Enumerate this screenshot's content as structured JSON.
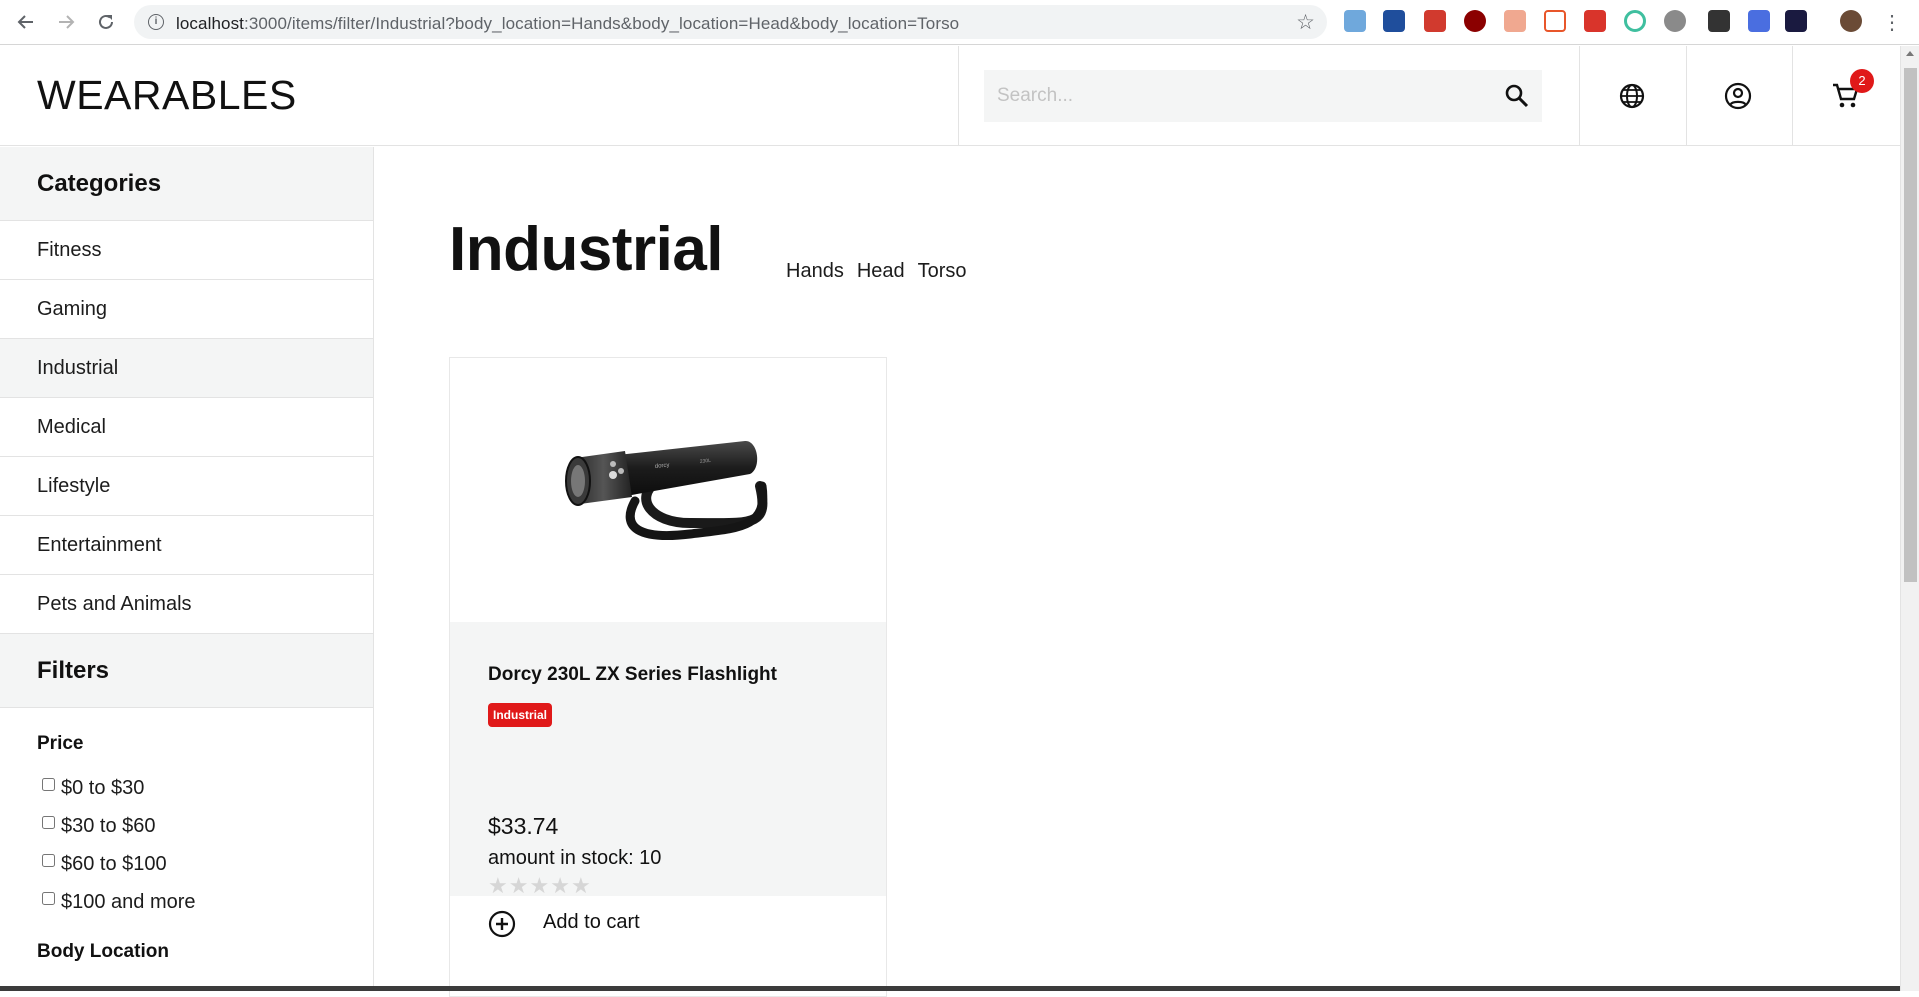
{
  "browser": {
    "url_host": "localhost",
    "url_rest": ":3000/items/filter/Industrial?body_location=Hands&body_location=Head&body_location=Torso"
  },
  "header": {
    "logo": "WEARABLES",
    "search_placeholder": "Search...",
    "cart_count": "2"
  },
  "sidebar": {
    "categories_title": "Categories",
    "categories": [
      "Fitness",
      "Gaming",
      "Industrial",
      "Medical",
      "Lifestyle",
      "Entertainment",
      "Pets and Animals"
    ],
    "active_category": "Industrial",
    "filters_title": "Filters",
    "price_title": "Price",
    "price_options": [
      "$0 to $30",
      "$30 to $60",
      "$60 to $100",
      "$100 and more"
    ],
    "body_location_title": "Body Location"
  },
  "main": {
    "title": "Industrial",
    "tags": [
      "Hands",
      "Head",
      "Torso"
    ]
  },
  "product": {
    "name": "Dorcy 230L ZX Series Flashlight",
    "category_badge": "Industrial",
    "price": "$33.74",
    "stock": "amount in stock: 10",
    "rating": 0,
    "rating_max": 5,
    "add_to_cart": "Add to cart"
  },
  "colors": {
    "badge": "#e01919",
    "panel_bg": "#f4f5f5"
  }
}
